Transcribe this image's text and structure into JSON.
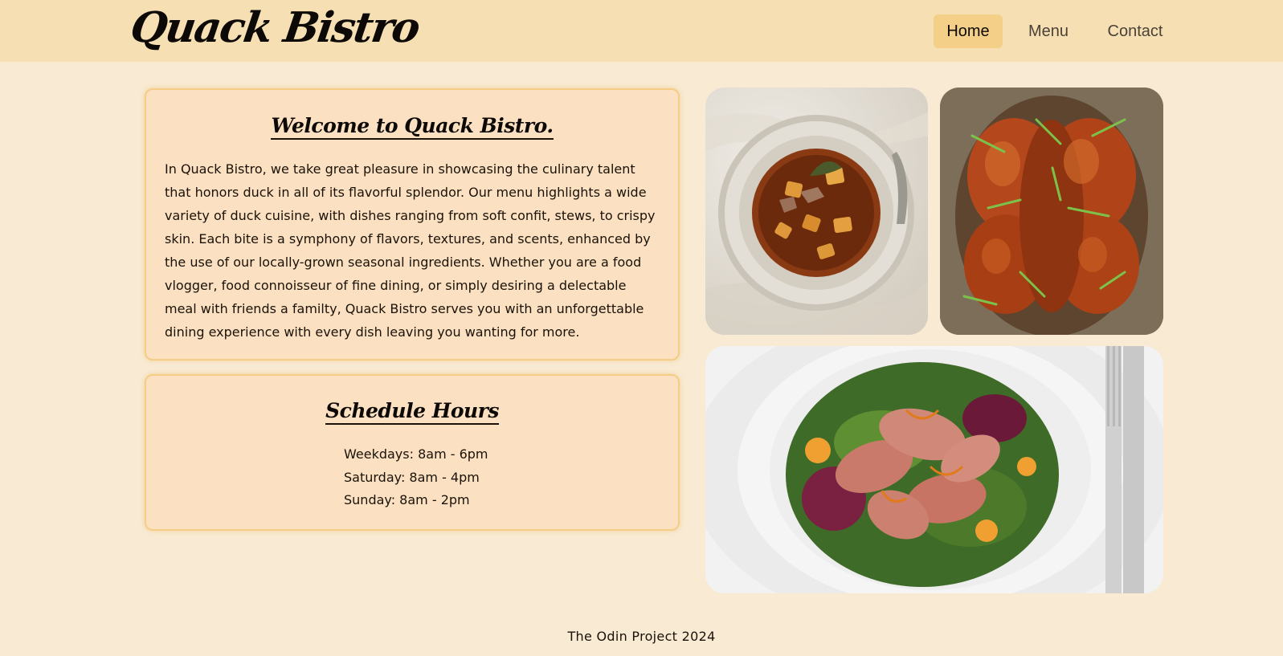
{
  "header": {
    "brand": "Quack Bistro",
    "nav": [
      {
        "label": "Home",
        "active": true
      },
      {
        "label": "Menu",
        "active": false
      },
      {
        "label": "Contact",
        "active": false
      }
    ]
  },
  "welcome": {
    "title": "Welcome to Quack Bistro.",
    "text": "In Quack Bistro, we take great pleasure in showcasing the culinary talent that honors duck in all of its flavorful splendor. Our menu highlights a wide variety of duck cuisine, with dishes ranging from soft confit, stews, to crispy skin. Each bite is a symphony of flavors, textures, and scents, enhanced by the use of our locally-grown seasonal ingredients. Whether you are a food vlogger, food connoisseur of fine dining, or simply desiring a delectable meal with friends a familty, Quack Bistro serves you with an unforgettable dining experience with every dish leaving you wanting for more."
  },
  "hours": {
    "title": "Schedule Hours",
    "items": [
      "Weekdays: 8am - 6pm",
      "Saturday: 8am - 4pm",
      "Sunday: 8am - 2pm"
    ]
  },
  "gallery": [
    {
      "icon": "duck-stew-photo"
    },
    {
      "icon": "roast-duck-photo"
    },
    {
      "icon": "duck-salad-photo"
    }
  ],
  "footer": {
    "text": "The Odin Project 2024"
  },
  "colors": {
    "page_background": "#f8ead3",
    "header_background": "#f6e0b3",
    "card_background": "#fbe1c2",
    "card_border": "#f4cd87",
    "nav_active": "#f4cf88"
  }
}
